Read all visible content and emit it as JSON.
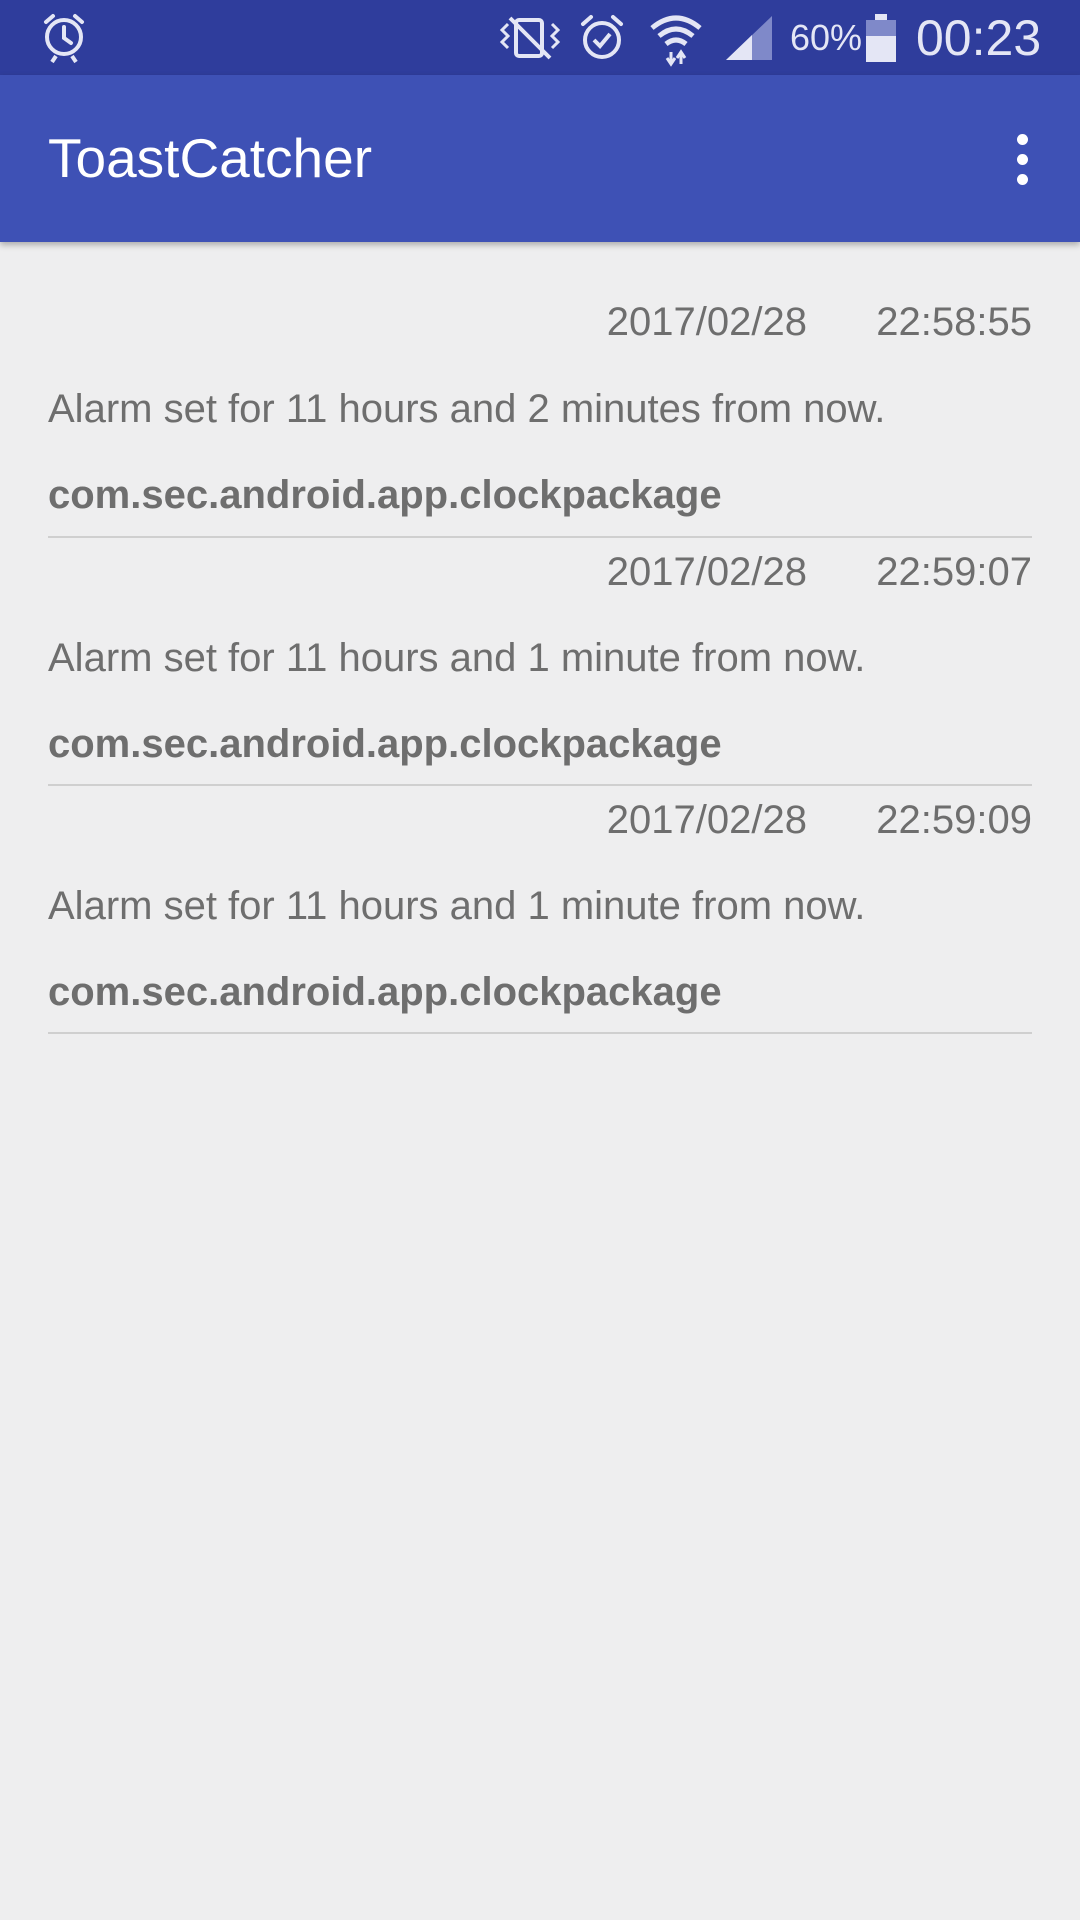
{
  "status_bar": {
    "left_icon": "alarm-sync-icon",
    "icons": [
      "vibrate-icon",
      "alarm-icon",
      "wifi-icon",
      "signal-icon",
      "battery-icon"
    ],
    "battery": "60%",
    "battery_level": 0.6,
    "time": "00:23"
  },
  "app_bar": {
    "title": "ToastCatcher",
    "menu_icon": "more-vert-icon"
  },
  "items": [
    {
      "date": "2017/02/28",
      "time": "22:58:55",
      "message": "Alarm set for 11 hours and 2 minutes from now.",
      "package": "com.sec.android.app.clockpackage"
    },
    {
      "date": "2017/02/28",
      "time": "22:59:07",
      "message": "Alarm set for 11 hours and 1 minute from now.",
      "package": "com.sec.android.app.clockpackage"
    },
    {
      "date": "2017/02/28",
      "time": "22:59:09",
      "message": "Alarm set for 11 hours and 1 minute from now.",
      "package": "com.sec.android.app.clockpackage"
    }
  ],
  "colors": {
    "status_bar": "#2f3d9c",
    "app_bar": "#3e51b5",
    "background": "#eeeeef",
    "text": "#6e6e6e"
  }
}
